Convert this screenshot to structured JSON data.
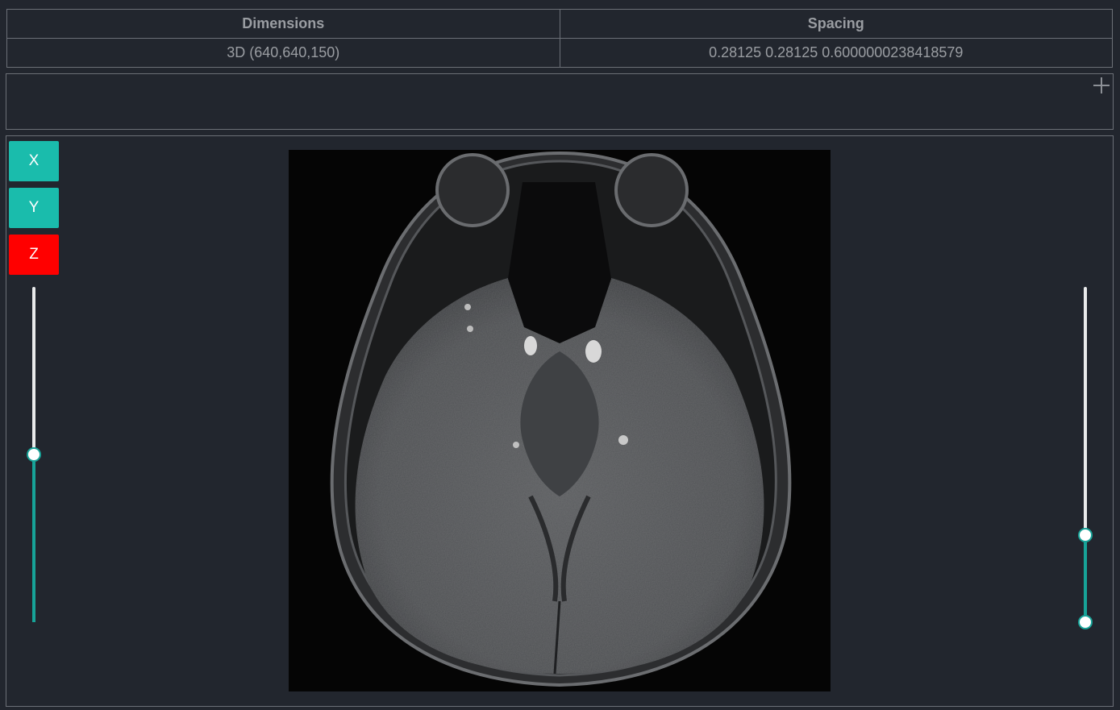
{
  "info": {
    "headers": [
      "Dimensions",
      "Spacing"
    ],
    "values": [
      "3D (640,640,150)",
      "0.28125 0.28125 0.6000000238418579"
    ]
  },
  "toolbar": {
    "add_icon": "plus-icon"
  },
  "axes": {
    "buttons": [
      {
        "label": "X",
        "color": "#1abcac",
        "active": false
      },
      {
        "label": "Y",
        "color": "#1abcac",
        "active": false
      },
      {
        "label": "Z",
        "color": "#ff0000",
        "active": true
      }
    ]
  },
  "slice_slider": {
    "orientation": "vertical",
    "value_fraction": 0.5
  },
  "window_slider": {
    "orientation": "vertical",
    "type": "range",
    "low_fraction": 0.0,
    "high_fraction": 0.26
  },
  "viewer": {
    "image_content": "axial brain MRI slice"
  },
  "colors": {
    "accent": "#17a398",
    "background": "#22262e",
    "border": "#6c7077",
    "text": "#9a9da2"
  }
}
